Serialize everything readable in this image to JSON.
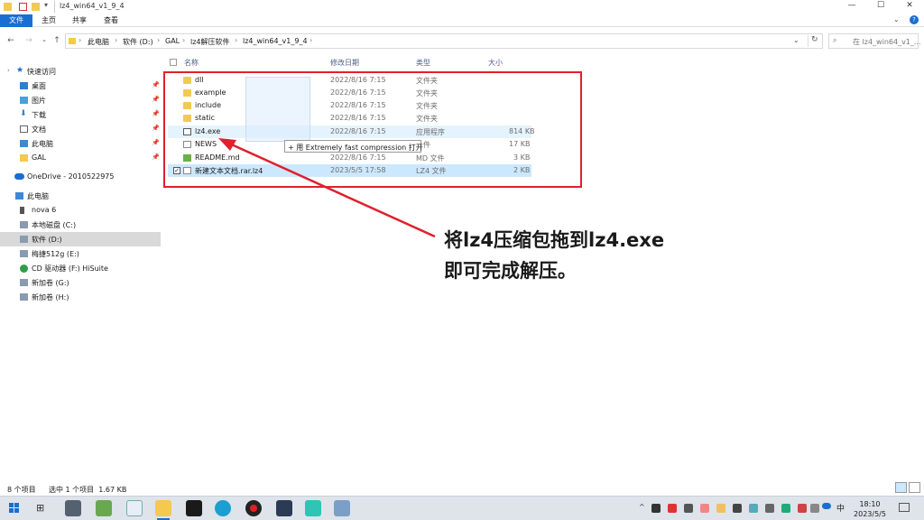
{
  "window": {
    "title": "lz4_win64_v1_9_4",
    "controls": {
      "minimize": "—",
      "maximize": "☐",
      "close": "✕"
    }
  },
  "ribbon": {
    "tabs": [
      "文件",
      "主页",
      "共享",
      "查看"
    ],
    "help": "?"
  },
  "address": {
    "crumbs": [
      "此电脑",
      "软件 (D:)",
      "GAL",
      "lz4解压软件",
      "lz4_win64_v1_9_4"
    ],
    "search_placeholder": "在 lz4_win64_v1_..."
  },
  "nav": {
    "quick_access": "快速访问",
    "quick_items": [
      "桌面",
      "图片",
      "下载",
      "文档",
      "此电脑",
      "GAL"
    ],
    "onedrive": "OneDrive - 2010522975",
    "this_pc": "此电脑",
    "pc_items": [
      "nova 6",
      "本地磁盘 (C:)",
      "软件 (D:)",
      "梅捷512g (E:)",
      "CD 驱动器 (F:) HiSuite",
      "新加卷 (G:)",
      "新加卷 (H:)"
    ]
  },
  "columns": {
    "name": "名称",
    "date": "修改日期",
    "type": "类型",
    "size": "大小"
  },
  "files": [
    {
      "name": "dll",
      "date": "2022/8/16 7:15",
      "type": "文件夹",
      "size": "",
      "icon": "folder"
    },
    {
      "name": "example",
      "date": "2022/8/16 7:15",
      "type": "文件夹",
      "size": "",
      "icon": "folder"
    },
    {
      "name": "include",
      "date": "2022/8/16 7:15",
      "type": "文件夹",
      "size": "",
      "icon": "folder"
    },
    {
      "name": "static",
      "date": "2022/8/16 7:15",
      "type": "文件夹",
      "size": "",
      "icon": "folder"
    },
    {
      "name": "lz4.exe",
      "date": "2022/8/16 7:15",
      "type": "应用程序",
      "size": "814 KB",
      "icon": "exe"
    },
    {
      "name": "NEWS",
      "date": "",
      "type": "件",
      "size": "17 KB",
      "icon": "doc"
    },
    {
      "name": "README.md",
      "date": "2022/8/16 7:15",
      "type": "MD 文件",
      "size": "3 KB",
      "icon": "md"
    },
    {
      "name": "新建文本文档.rar.lz4",
      "date": "2023/5/5 17:58",
      "type": "LZ4 文件",
      "size": "2 KB",
      "icon": "doc"
    }
  ],
  "tooltip": "+ 用 Extremely fast compression 打开",
  "annotation": {
    "line1": "将lz4压缩包拖到lz4.exe",
    "line2": "即可完成解压。"
  },
  "status": {
    "count": "8 个项目",
    "selected": "选中 1 个项目  1.67 KB"
  },
  "taskbar": {
    "time": "18:10",
    "date": "2023/5/5",
    "ime": "中"
  },
  "colors": {
    "accent": "#1a6ed1",
    "annotation_red": "#e0202c",
    "folder": "#f3c94f"
  }
}
